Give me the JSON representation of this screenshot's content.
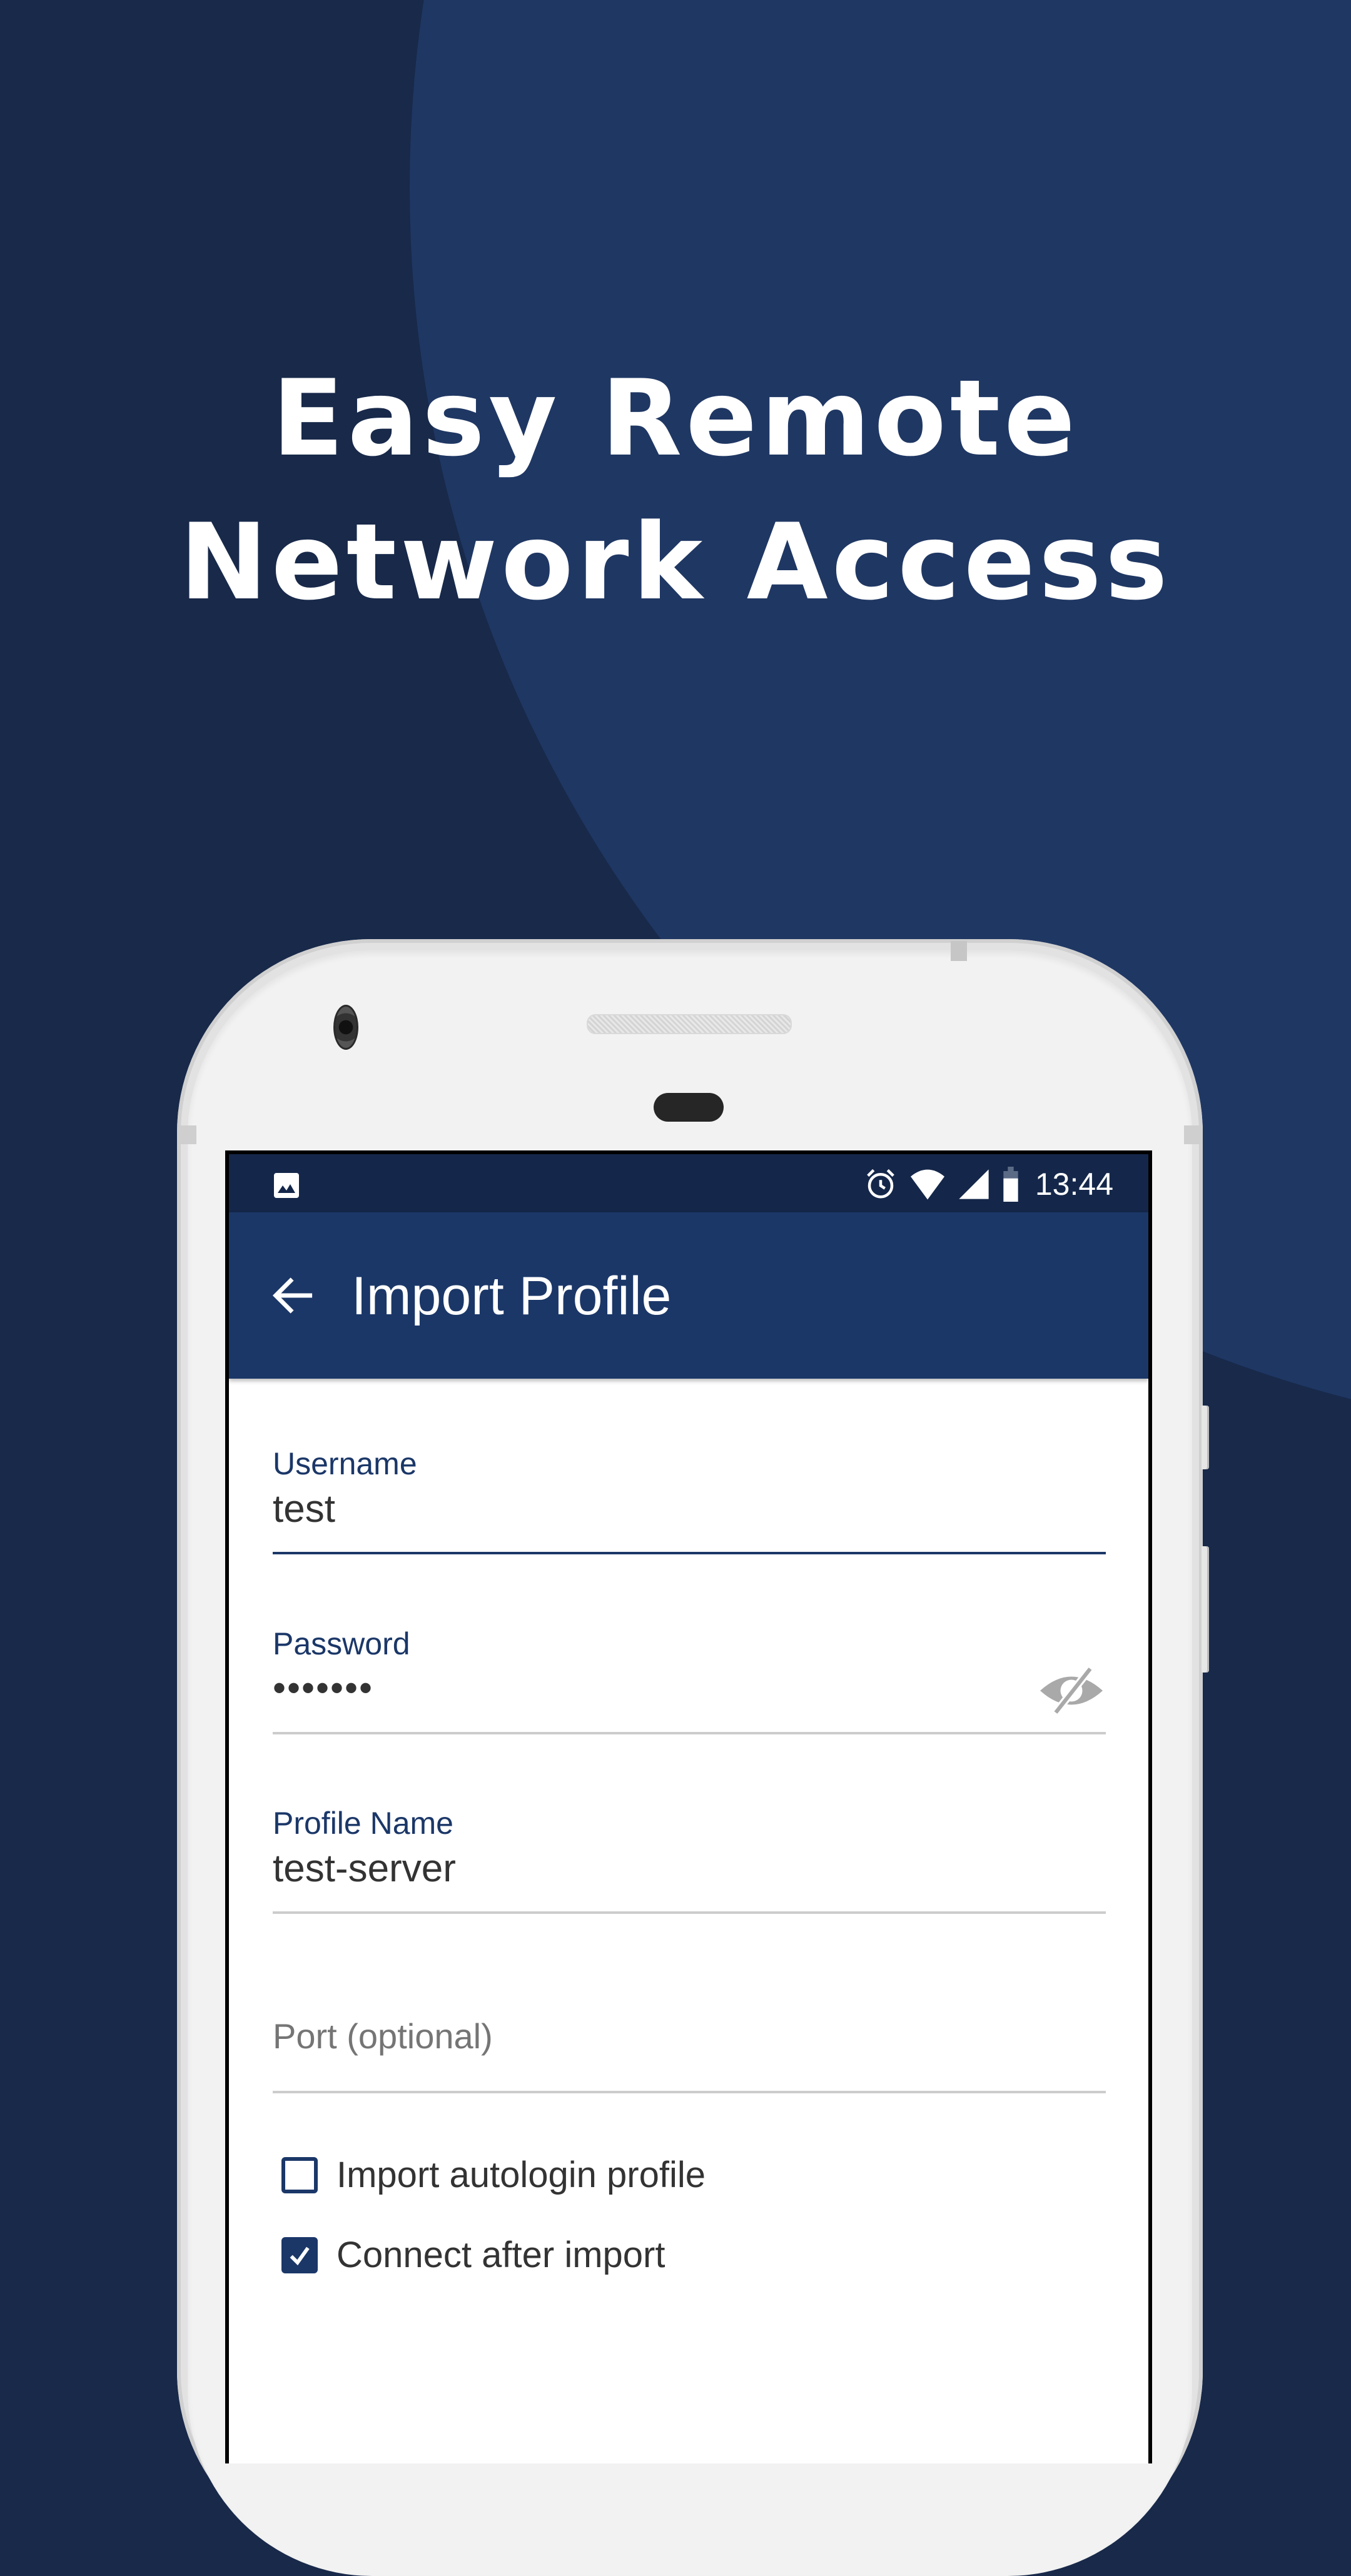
{
  "marketing": {
    "headline_line1": "Easy Remote",
    "headline_line2": "Network Access"
  },
  "colors": {
    "background_dark": "#18294a",
    "background_light": "#1f3763",
    "status_bar": "#14274a",
    "app_bar": "#1b3768",
    "accent": "#1b3768",
    "text_primary": "#333333",
    "hint": "#757575",
    "divider": "#cccccc"
  },
  "status_bar": {
    "left_icons": [
      "gallery-icon"
    ],
    "right_icons": [
      "alarm-icon",
      "wifi-icon",
      "signal-icon",
      "battery-icon"
    ],
    "time": "13:44"
  },
  "app_bar": {
    "back_icon": "arrow-left-icon",
    "title": "Import Profile"
  },
  "form": {
    "username": {
      "label": "Username",
      "value": "test",
      "focused": true
    },
    "password": {
      "label": "Password",
      "value": "•••••••",
      "toggle_icon": "eye-off-icon"
    },
    "profile_name": {
      "label": "Profile Name",
      "value": "test-server"
    },
    "port": {
      "placeholder": "Port (optional)",
      "value": ""
    },
    "checkboxes": [
      {
        "label": "Import autologin profile",
        "checked": false
      },
      {
        "label": "Connect after import",
        "checked": true
      }
    ]
  }
}
